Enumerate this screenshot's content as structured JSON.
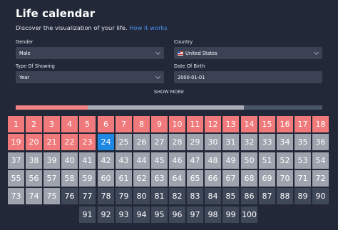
{
  "header": {
    "title": "Life calendar",
    "subtitle": "Discover the visualization of your life.",
    "link": "How it works"
  },
  "form": {
    "gender": {
      "label": "Gender",
      "value": "Male"
    },
    "country": {
      "label": "Country",
      "value": "United States",
      "icon": "us-flag-icon"
    },
    "type_of_showing": {
      "label": "Type Of Showing",
      "value": "Year"
    },
    "date_of_birth": {
      "label": "Date Of Birth",
      "value": "2000-01-01"
    },
    "show_more": "SHOW MORE"
  },
  "progress": {
    "lived_fraction": 0.235,
    "expected_fraction": 0.744
  },
  "calendar": {
    "total": 100,
    "current": 24,
    "expected_last": 75,
    "colors": {
      "past": "#f07a7b",
      "current": "#1e88e5",
      "expected": "#9ea3ad",
      "beyond": "#3f4859"
    }
  }
}
